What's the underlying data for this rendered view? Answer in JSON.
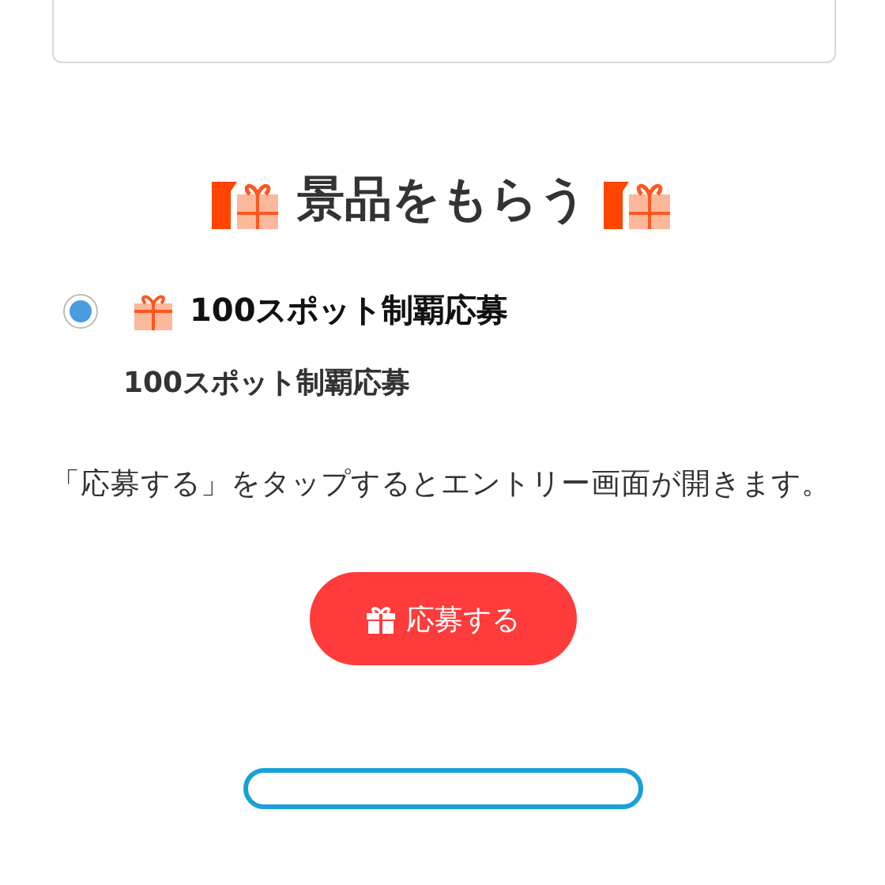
{
  "heading": "景品をもらう",
  "options": [
    {
      "label": "100スポット制覇応募",
      "selected": true
    }
  ],
  "prize_name": "100スポット制覇応募",
  "note": "「応募する」をタップするとエントリー画面が開きます。",
  "apply_button": {
    "label": "応募する"
  }
}
